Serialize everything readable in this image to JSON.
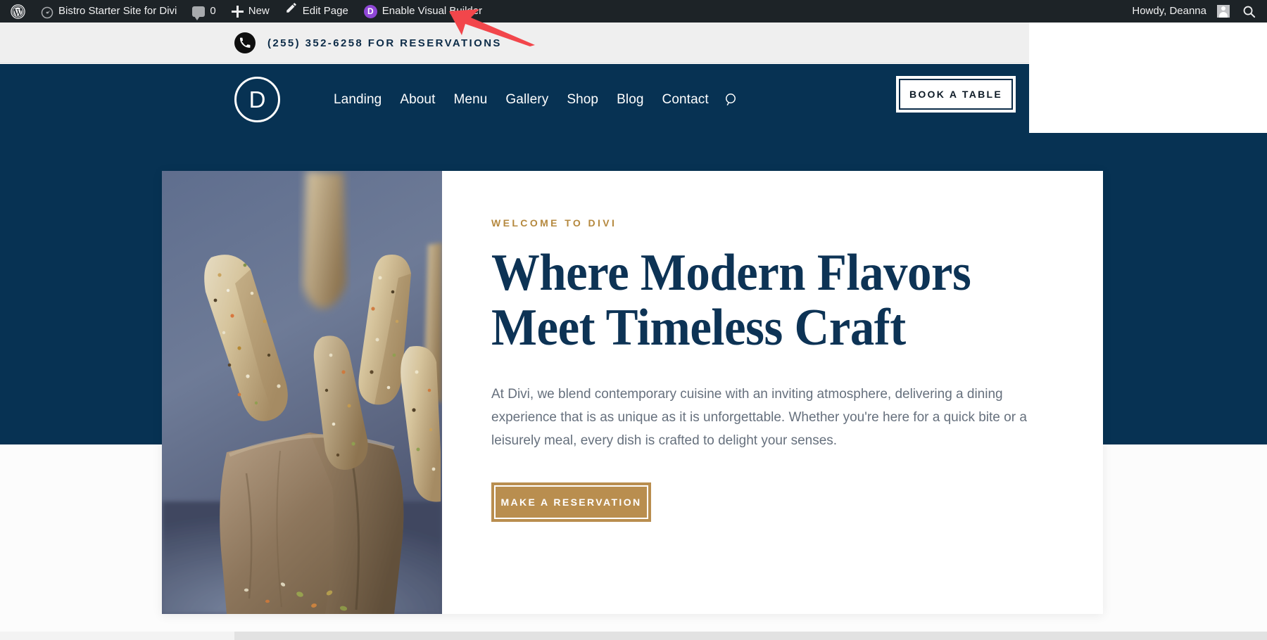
{
  "admin_bar": {
    "wp_logo_icon": "wordpress-logo-icon",
    "site_icon": "dashboard-icon",
    "site_name": "Bistro Starter Site for Divi",
    "comments_icon": "comment-bubble-icon",
    "comments_count": "0",
    "new_icon": "plus-icon",
    "new_label": "New",
    "edit_page_icon": "pencil-icon",
    "edit_page_label": "Edit Page",
    "divi_badge_letter": "D",
    "visual_builder_label": "Enable Visual Builder",
    "howdy_label": "Howdy, Deanna",
    "avatar_icon": "user-avatar-icon",
    "search_icon": "search-icon"
  },
  "topbar": {
    "phone_icon": "phone-icon",
    "phone_text": "(255) 352-6258 FOR RESERVATIONS"
  },
  "header": {
    "logo_letter": "D",
    "logo_icon": "divi-circle-logo-icon",
    "menu": [
      {
        "label": "Landing"
      },
      {
        "label": "About"
      },
      {
        "label": "Menu"
      },
      {
        "label": "Gallery"
      },
      {
        "label": "Shop"
      },
      {
        "label": "Blog"
      },
      {
        "label": "Contact"
      }
    ],
    "search_icon": "search-icon",
    "book_table_label": "BOOK A TABLE"
  },
  "hero": {
    "image_icon": "breadsticks-in-paper-bag-photo",
    "eyebrow": "WELCOME TO DIVI",
    "title": "Where Modern Flavors\nMeet Timeless Craft",
    "paragraph": "At Divi, we blend contemporary cuisine with an inviting atmosphere, delivering a dining experience that is as unique as it is unforgettable. Whether you're here for a quick bite or a leisurely meal, every dish is crafted to delight your senses.",
    "cta_label": "MAKE A RESERVATION"
  },
  "annotation": {
    "arrow_icon": "red-pointer-arrow-icon",
    "arrow_color": "#f2464b"
  },
  "colors": {
    "navy": "#073253",
    "gold": "#b98e4f",
    "eyebrow_gold": "#b5893f",
    "admin_bar": "#1d2327",
    "topbar_bg": "#efefef",
    "heading_navy": "#0d3355",
    "body_gray": "#66707d",
    "divi_purple": "#8f47d6"
  }
}
